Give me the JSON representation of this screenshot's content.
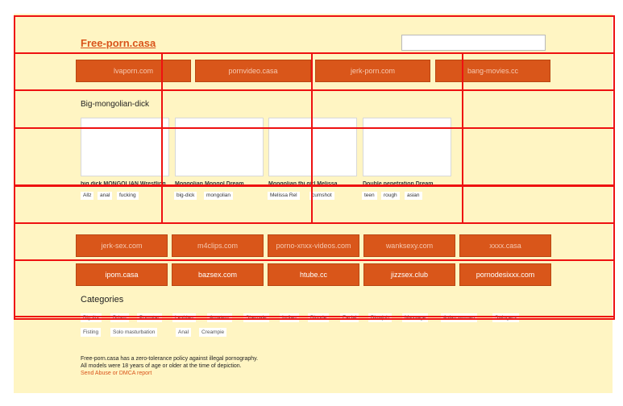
{
  "header": {
    "site_title": "Free-porn.casa",
    "search_value": ""
  },
  "top_links": [
    "lvaporn.com",
    "pornvideo.casa",
    "jerk-porn.com",
    "bang-movies.cc"
  ],
  "gallery": {
    "heading": "Big-mongolian-dick",
    "videos": [
      {
        "title": "big dick MONGOLIAN Wrestling",
        "tags": [
          "Allz",
          "anal",
          "fucking"
        ]
      },
      {
        "title": "Mongolian Mongol Dream",
        "tags": [
          "big-dick",
          "mongolian"
        ]
      },
      {
        "title": "Mongolian thi girl Melissa",
        "tags": [
          "Melissa Rel",
          "cumshot"
        ]
      },
      {
        "title": "Double penetration Dream",
        "tags": [
          "teen",
          "rough",
          "asian"
        ]
      }
    ]
  },
  "link_rows": [
    [
      "jerk-sex.com",
      "m4clips.com",
      "porno-xnxx-videos.com",
      "wanksexy.com",
      "xxxx.casa"
    ],
    [
      "ipom.casa",
      "bazsex.com",
      "htube.cc",
      "jizzsex.club",
      "pornodesixxx.com"
    ]
  ],
  "categories": {
    "heading": "Categories",
    "items": [
      "Big tits",
      "Bdsm",
      "Pornstar",
      "Lesbian",
      "Amateur",
      "Shemale",
      "Indian",
      "Blonde",
      "Facial",
      "Blowjob",
      "Massage",
      "Asian woman",
      "Swingers",
      "Fisting",
      "Solo masturbation",
      "Anal",
      "Creampie"
    ]
  },
  "footer": {
    "line1": "Free-porn.casa has a zero-tolerance policy against illegal pornography.",
    "line2": "All models were 18 years of age or older at the time of depiction.",
    "link": "Send Abuse or DMCA report"
  },
  "colors": {
    "page_bg": "#fff5c3",
    "accent": "#d9541b",
    "overlay": "#ee1111"
  }
}
